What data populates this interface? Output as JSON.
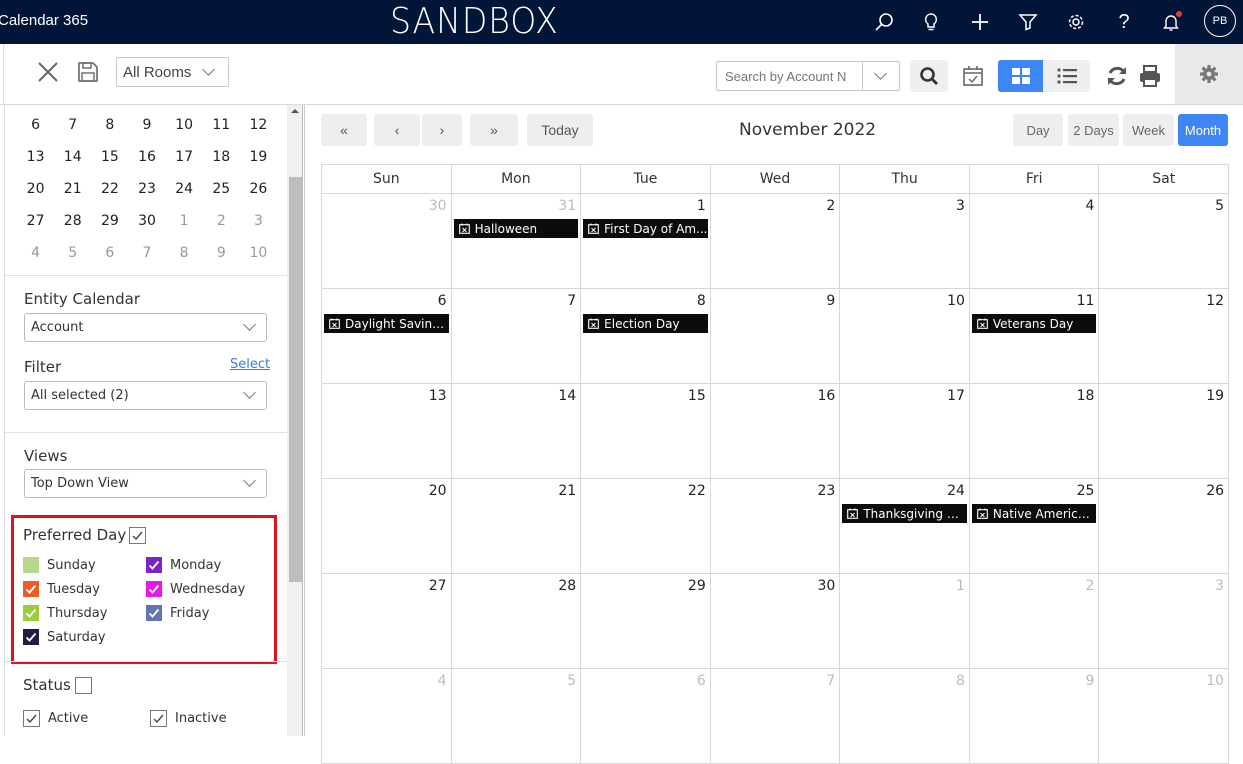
{
  "header": {
    "app_name": "Calendar 365",
    "environment": "SANDBOX",
    "icons": [
      "search-icon",
      "lightbulb-icon",
      "plus-icon",
      "filter-icon",
      "gear-icon",
      "help-icon",
      "bell-icon"
    ],
    "avatar_initials": "PB",
    "has_notification": true
  },
  "toolbar": {
    "rooms_select": "All Rooms",
    "search_placeholder": "Search by Account N",
    "active_view_toggle": "grid",
    "accent_color": "#3d86f4"
  },
  "mini_calendar": {
    "rows": [
      [
        {
          "d": "6"
        },
        {
          "d": "7"
        },
        {
          "d": "8"
        },
        {
          "d": "9"
        },
        {
          "d": "10"
        },
        {
          "d": "11"
        },
        {
          "d": "12"
        }
      ],
      [
        {
          "d": "13"
        },
        {
          "d": "14"
        },
        {
          "d": "15"
        },
        {
          "d": "16"
        },
        {
          "d": "17"
        },
        {
          "d": "18"
        },
        {
          "d": "19"
        }
      ],
      [
        {
          "d": "20"
        },
        {
          "d": "21"
        },
        {
          "d": "22"
        },
        {
          "d": "23"
        },
        {
          "d": "24"
        },
        {
          "d": "25"
        },
        {
          "d": "26"
        }
      ],
      [
        {
          "d": "27"
        },
        {
          "d": "28"
        },
        {
          "d": "29"
        },
        {
          "d": "30"
        },
        {
          "d": "1",
          "muted": true
        },
        {
          "d": "2",
          "muted": true
        },
        {
          "d": "3",
          "muted": true
        }
      ],
      [
        {
          "d": "4",
          "muted": true
        },
        {
          "d": "5",
          "muted": true
        },
        {
          "d": "6",
          "muted": true
        },
        {
          "d": "7",
          "muted": true
        },
        {
          "d": "8",
          "muted": true
        },
        {
          "d": "9",
          "muted": true
        },
        {
          "d": "10",
          "muted": true
        }
      ]
    ]
  },
  "sidebar": {
    "entity_calendar": {
      "label": "Entity Calendar",
      "value": "Account"
    },
    "filter": {
      "label": "Filter",
      "link": "Select",
      "value": "All selected (2)"
    },
    "views": {
      "label": "Views",
      "value": "Top Down View"
    },
    "preferred_day": {
      "label": "Preferred Day",
      "checked": true,
      "days": [
        {
          "name": "Sunday",
          "color": "#b5d98a",
          "checked": false
        },
        {
          "name": "Monday",
          "color": "#7b22c9",
          "checked": true
        },
        {
          "name": "Tuesday",
          "color": "#f05a23",
          "checked": true
        },
        {
          "name": "Wednesday",
          "color": "#e619e6",
          "checked": true
        },
        {
          "name": "Thursday",
          "color": "#9ccc3c",
          "checked": true
        },
        {
          "name": "Friday",
          "color": "#6474b3",
          "checked": true
        },
        {
          "name": "Saturday",
          "color": "#221c44",
          "checked": true
        }
      ]
    },
    "status": {
      "label": "Status",
      "checked": false,
      "options": [
        {
          "name": "Active",
          "checked": true
        },
        {
          "name": "Inactive",
          "checked": true
        }
      ]
    }
  },
  "calendar": {
    "title": "November 2022",
    "nav": {
      "first": "«",
      "prev": "‹",
      "next": "›",
      "last": "»",
      "today": "Today"
    },
    "views": [
      "Day",
      "2 Days",
      "Week",
      "Month"
    ],
    "active_view": "Month",
    "weekdays": [
      "Sun",
      "Mon",
      "Tue",
      "Wed",
      "Thu",
      "Fri",
      "Sat"
    ],
    "weeks": [
      [
        {
          "d": "30",
          "muted": true
        },
        {
          "d": "31",
          "muted": true,
          "event": "Halloween"
        },
        {
          "d": "1",
          "event": "First Day of Am..."
        },
        {
          "d": "2"
        },
        {
          "d": "3"
        },
        {
          "d": "4"
        },
        {
          "d": "5"
        }
      ],
      [
        {
          "d": "6",
          "event": "Daylight Saving ..."
        },
        {
          "d": "7"
        },
        {
          "d": "8",
          "event": "Election Day"
        },
        {
          "d": "9"
        },
        {
          "d": "10"
        },
        {
          "d": "11",
          "event": "Veterans Day"
        },
        {
          "d": "12"
        }
      ],
      [
        {
          "d": "13"
        },
        {
          "d": "14"
        },
        {
          "d": "15"
        },
        {
          "d": "16"
        },
        {
          "d": "17"
        },
        {
          "d": "18"
        },
        {
          "d": "19"
        }
      ],
      [
        {
          "d": "20"
        },
        {
          "d": "21"
        },
        {
          "d": "22"
        },
        {
          "d": "23"
        },
        {
          "d": "24",
          "event": "Thanksgiving Day"
        },
        {
          "d": "25",
          "event": "Native America..."
        },
        {
          "d": "26"
        }
      ],
      [
        {
          "d": "27"
        },
        {
          "d": "28"
        },
        {
          "d": "29"
        },
        {
          "d": "30"
        },
        {
          "d": "1",
          "muted": true
        },
        {
          "d": "2",
          "muted": true
        },
        {
          "d": "3",
          "muted": true
        }
      ],
      [
        {
          "d": "4",
          "muted": true
        },
        {
          "d": "5",
          "muted": true
        },
        {
          "d": "6",
          "muted": true
        },
        {
          "d": "7",
          "muted": true
        },
        {
          "d": "8",
          "muted": true
        },
        {
          "d": "9",
          "muted": true
        },
        {
          "d": "10",
          "muted": true
        }
      ]
    ]
  }
}
